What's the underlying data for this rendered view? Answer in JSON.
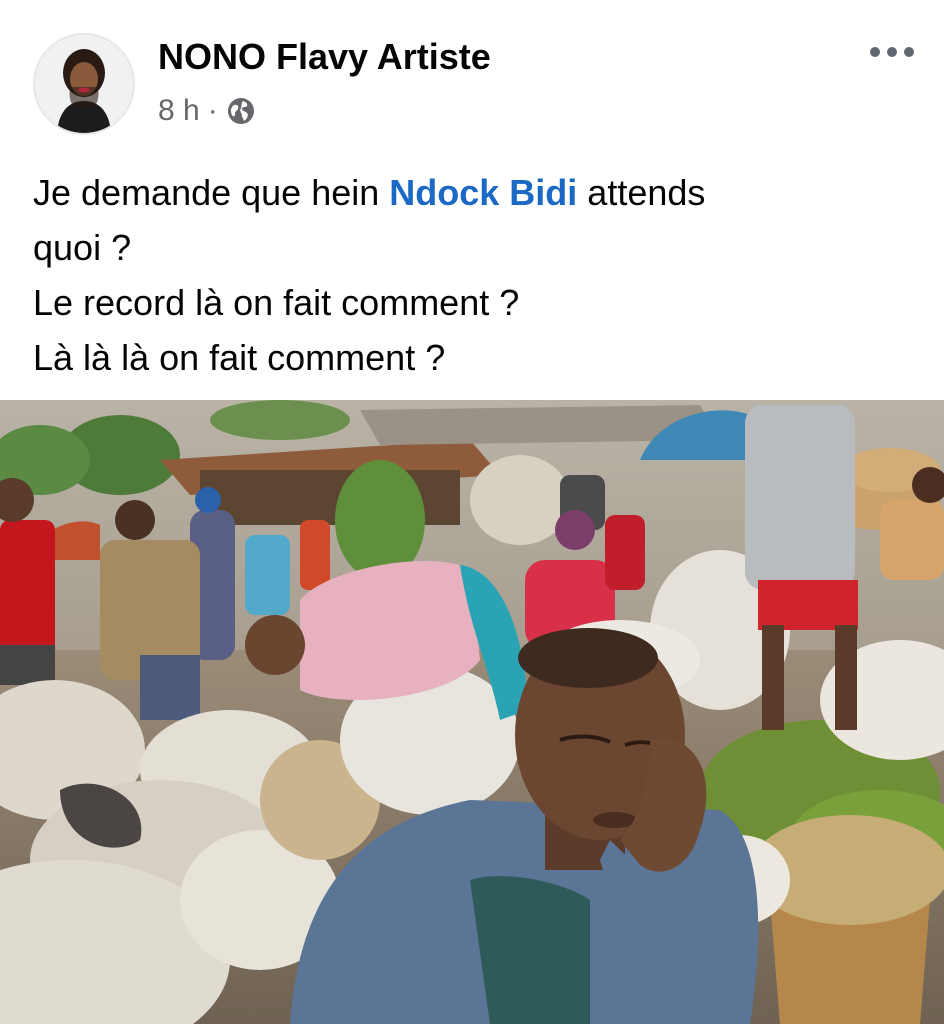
{
  "post": {
    "author": "NONO Flavy Artiste",
    "time": "8 h",
    "separator": "·",
    "audience_icon": "globe-icon",
    "more_icon": "more-options-icon",
    "text": {
      "line1_prefix": "Je demande que hein ",
      "mention": "Ndock Bidi",
      "line1_suffix": " attends",
      "line2": "quoi ?",
      "line3": "Le record là on fait comment ?",
      "line4": "Là là là on fait comment ?"
    },
    "photo": {
      "subject": "man resting head on hand in busy market with sacks of produce"
    }
  },
  "colors": {
    "mention": "#1a69c4",
    "author": "#050505",
    "meta": "#65676b"
  }
}
